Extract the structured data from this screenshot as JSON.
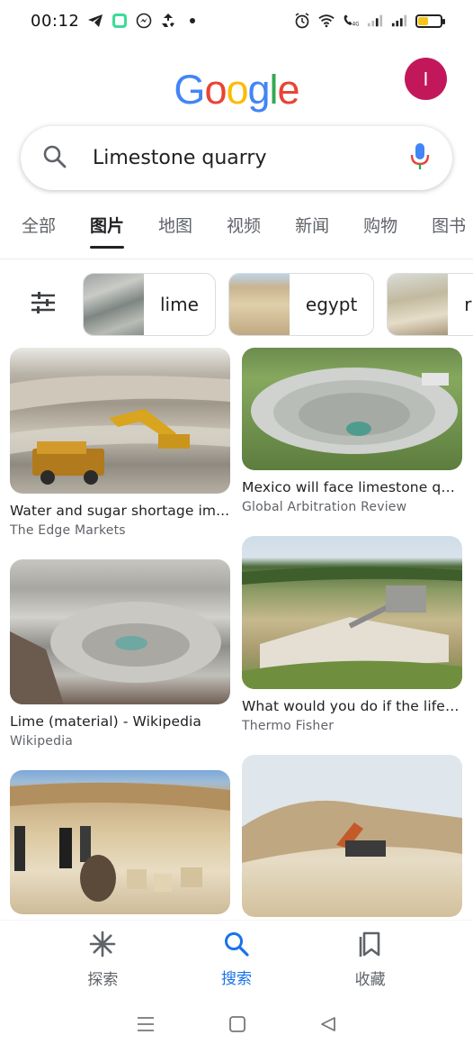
{
  "status_bar": {
    "time": "00:12",
    "left_icons": [
      "telegram-icon",
      "app-icon",
      "messenger-icon",
      "recycle-icon",
      "dot-icon"
    ],
    "right_icons": [
      "alarm-icon",
      "wifi-icon",
      "volte-icon",
      "signal-icon",
      "signal-icon",
      "battery-icon"
    ]
  },
  "header": {
    "logo": [
      "G",
      "o",
      "o",
      "g",
      "l",
      "e"
    ],
    "logo_colors": [
      "#4285F4",
      "#EA4335",
      "#FBBC05",
      "#4285F4",
      "#34A853",
      "#EA4335"
    ],
    "avatar_letter": "I",
    "avatar_color": "#C2185B"
  },
  "search": {
    "query": "Limestone quarry",
    "icon": "search-icon",
    "mic_icon": "mic-icon"
  },
  "tabs": [
    {
      "label": "全部",
      "active": false
    },
    {
      "label": "图片",
      "active": true
    },
    {
      "label": "地图",
      "active": false
    },
    {
      "label": "视频",
      "active": false
    },
    {
      "label": "新闻",
      "active": false
    },
    {
      "label": "购物",
      "active": false
    },
    {
      "label": "图书",
      "active": false
    }
  ],
  "chips": [
    {
      "label": "lime"
    },
    {
      "label": "egypt"
    },
    {
      "label": "r"
    }
  ],
  "results": [
    {
      "title": "Water and sugar shortage im...",
      "source": "The Edge Markets"
    },
    {
      "title": "Mexico will face limestone qu...",
      "source": "Global Arbitration Review"
    },
    {
      "title": "Lime (material) - Wikipedia",
      "source": "Wikipedia"
    },
    {
      "title": "What would you do if the life ...",
      "source": "Thermo Fisher"
    },
    {
      "title": "",
      "source": ""
    },
    {
      "title": "",
      "source": ""
    }
  ],
  "bottom_nav": [
    {
      "label": "探索",
      "icon": "asterisk-icon",
      "active": false
    },
    {
      "label": "搜索",
      "icon": "search-icon",
      "active": true
    },
    {
      "label": "收藏",
      "icon": "bookmark-icon",
      "active": false
    }
  ],
  "system_nav": [
    "menu-icon",
    "home-icon",
    "back-icon"
  ],
  "colors": {
    "accent": "#1a73e8",
    "text": "#202124",
    "muted": "#5f6368"
  }
}
